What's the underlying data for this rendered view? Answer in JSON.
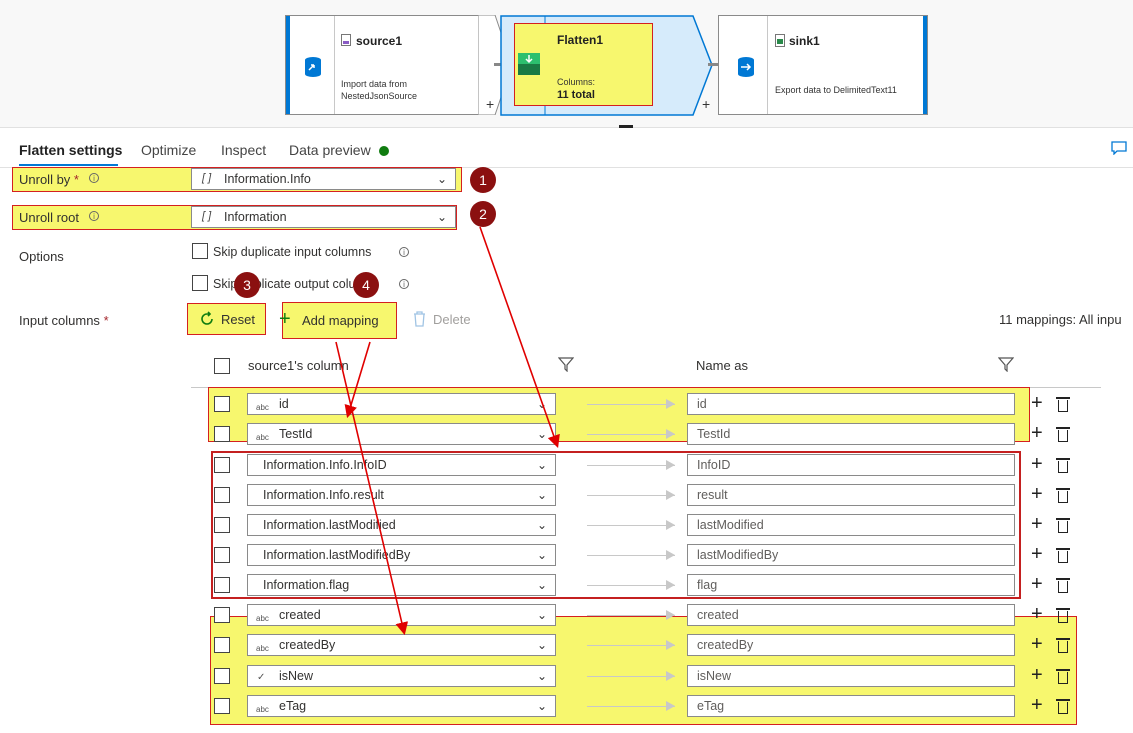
{
  "pipeline": {
    "source": {
      "title": "source1",
      "desc_line1": "Import data from",
      "desc_line2": "NestedJsonSource"
    },
    "flatten": {
      "title": "Flatten1",
      "columns_label": "Columns:",
      "columns_value": "11 total"
    },
    "sink": {
      "title": "sink1",
      "desc": "Export data to DelimitedText11"
    },
    "plus": "+"
  },
  "tabs": [
    {
      "label": "Flatten settings"
    },
    {
      "label": "Optimize"
    },
    {
      "label": "Inspect"
    },
    {
      "label": "Data preview"
    }
  ],
  "form": {
    "unroll_by_label": "Unroll by",
    "required_mark": "*",
    "unroll_by_value": "Information.Info",
    "unroll_root_label": "Unroll root",
    "unroll_root_value": "Information",
    "array_icon": "[ ]",
    "options_label": "Options",
    "skip_input": "Skip duplicate input columns",
    "skip_output": "Skip duplicate output columns",
    "input_columns_label": "Input columns",
    "reset": "Reset",
    "add_mapping": "Add mapping",
    "delete": "Delete",
    "mappings_summary": "11 mappings: All inpu"
  },
  "grid": {
    "source_header": "source1's column",
    "name_header": "Name as",
    "type_abc": "abc",
    "rows": [
      {
        "source": "id",
        "name": "id"
      },
      {
        "source": "TestId",
        "name": "TestId"
      },
      {
        "source": "Information.Info.InfoID",
        "name": "InfoID"
      },
      {
        "source": "Information.Info.result",
        "name": "result"
      },
      {
        "source": "Information.lastModified",
        "name": "lastModified"
      },
      {
        "source": "Information.lastModifiedBy",
        "name": "lastModifiedBy"
      },
      {
        "source": "Information.flag",
        "name": "flag"
      },
      {
        "source": "created",
        "name": "created"
      },
      {
        "source": "createdBy",
        "name": "createdBy"
      },
      {
        "source": "isNew",
        "name": "isNew"
      },
      {
        "source": "eTag",
        "name": "eTag"
      }
    ]
  },
  "badges": [
    "1",
    "2",
    "3",
    "4"
  ],
  "colors": {
    "highlight": "#f7f76e",
    "annotation_red": "#d42020",
    "badge": "#8b1010",
    "accent": "#0078d4",
    "status_green": "#107c10"
  }
}
